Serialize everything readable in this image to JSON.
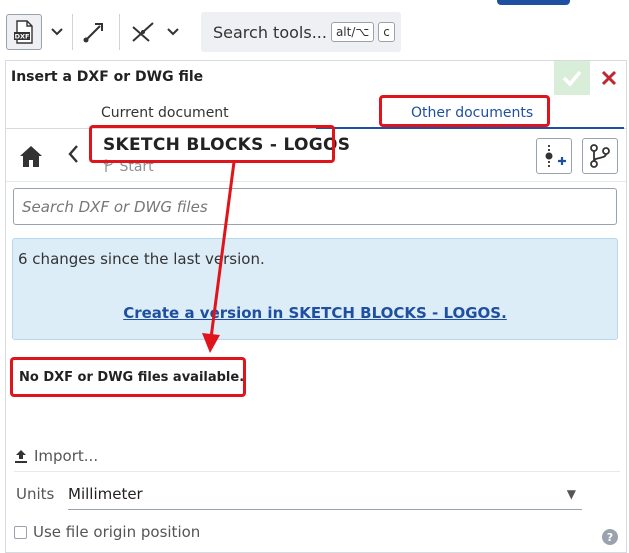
{
  "toolbar": {
    "search_tools_label": "Search tools...",
    "shortcut_key1": "alt/⌥",
    "shortcut_key2": "c",
    "dxf_icon_text": "DXF"
  },
  "dialog": {
    "title": "Insert a DXF or DWG file",
    "tabs": [
      {
        "label": "Current document",
        "active": false
      },
      {
        "label": "Other documents",
        "active": true
      }
    ],
    "document_title": "SKETCH BLOCKS - LOGOS",
    "branch_label": "Start",
    "search": {
      "placeholder": "Search DXF or DWG files",
      "value": ""
    },
    "info": {
      "changes_text": "6 changes since the last version.",
      "link_text": "Create a version in SKETCH BLOCKS - LOGOS."
    },
    "empty_text": "No DXF or DWG files available.",
    "import_label": "Import...",
    "units_label": "Units",
    "units_value": "Millimeter",
    "origin_label": "Use file origin position",
    "origin_checked": false,
    "help_symbol": "?"
  },
  "colors": {
    "accent": "#1f4fa0",
    "annotation": "#e0141b",
    "info_bg": "#dcedf8",
    "ok_green": "#d9eed9",
    "close_red": "#c0262d"
  }
}
